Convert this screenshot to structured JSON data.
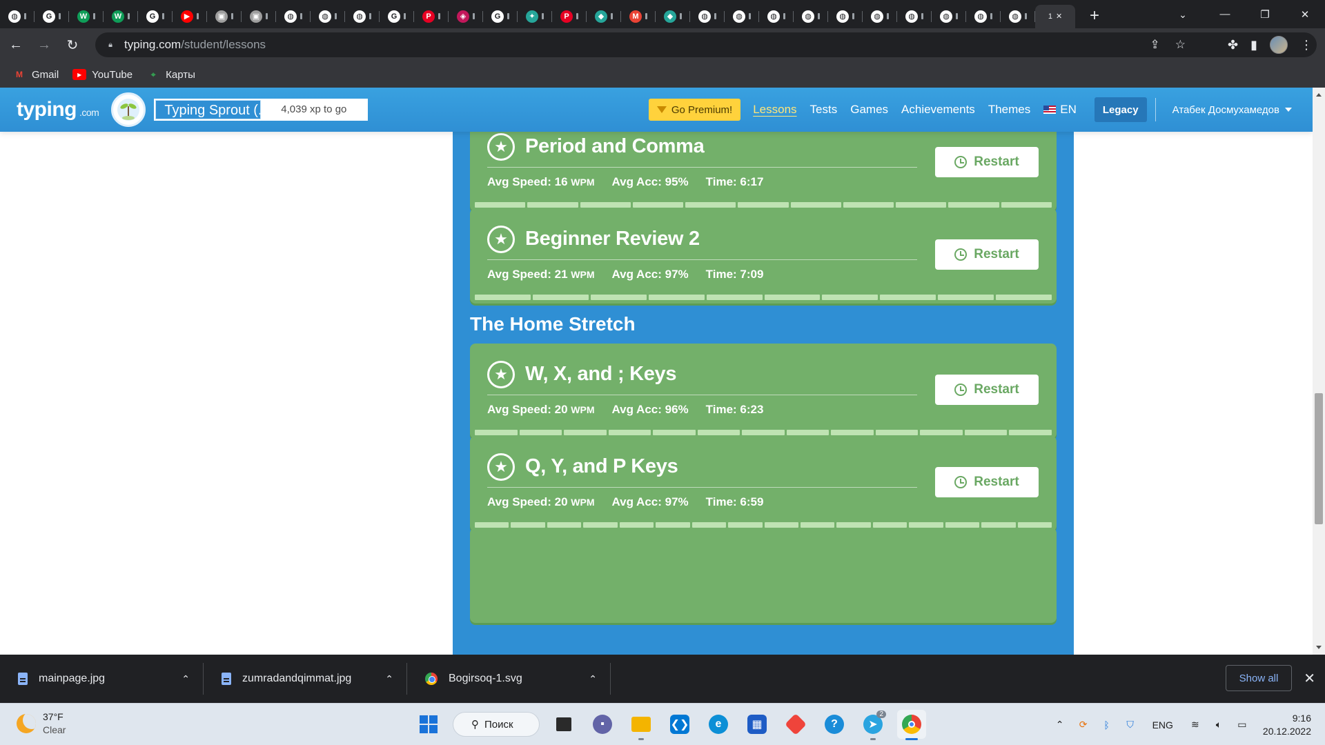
{
  "browser": {
    "tabs": [
      {
        "icon": "chrome-icon",
        "color": "#ffffff"
      },
      {
        "icon": "google-icon",
        "color": "#ffffff"
      },
      {
        "icon": "w-icon",
        "color": "#0f9d58"
      },
      {
        "icon": "w-icon",
        "color": "#0f9d58"
      },
      {
        "icon": "google-icon",
        "color": "#ffffff"
      },
      {
        "icon": "youtube-icon",
        "color": "#ff0000"
      },
      {
        "icon": "image-icon",
        "color": "#9e9e9e"
      },
      {
        "icon": "image-icon",
        "color": "#9e9e9e"
      },
      {
        "icon": "chrome-icon",
        "color": "#ffffff"
      },
      {
        "icon": "chrome-icon",
        "color": "#ffffff"
      },
      {
        "icon": "chrome-icon",
        "color": "#ffffff"
      },
      {
        "icon": "google-icon",
        "color": "#ffffff"
      },
      {
        "icon": "pinterest-icon",
        "color": "#e60023"
      },
      {
        "icon": "cube-icon",
        "color": "#c2185b"
      },
      {
        "icon": "google-icon",
        "color": "#ffffff"
      },
      {
        "icon": "spark-icon",
        "color": "#26a69a"
      },
      {
        "icon": "pinterest-icon",
        "color": "#e60023"
      },
      {
        "icon": "diamond-icon",
        "color": "#26a69a"
      },
      {
        "icon": "gmail-icon",
        "color": "#ea4335"
      },
      {
        "icon": "diamond-icon",
        "color": "#26a69a"
      },
      {
        "icon": "chrome-icon",
        "color": "#ffffff"
      },
      {
        "icon": "chrome-icon",
        "color": "#ffffff"
      },
      {
        "icon": "chrome-icon",
        "color": "#ffffff"
      },
      {
        "icon": "chrome-icon",
        "color": "#ffffff"
      },
      {
        "icon": "chrome-icon",
        "color": "#ffffff"
      },
      {
        "icon": "chrome-icon",
        "color": "#ffffff"
      },
      {
        "icon": "chrome-icon",
        "color": "#ffffff"
      },
      {
        "icon": "chrome-icon",
        "color": "#ffffff"
      },
      {
        "icon": "chrome-icon",
        "color": "#ffffff"
      },
      {
        "icon": "chrome-icon",
        "color": "#ffffff"
      }
    ],
    "active_tab_label": "1",
    "url_host": "typing.com",
    "url_path": "/student/lessons",
    "bookmarks": [
      {
        "label": "Gmail",
        "icon": "gmail-icon",
        "color": "#ea4335"
      },
      {
        "label": "YouTube",
        "icon": "youtube-icon",
        "color": "#ff0000"
      },
      {
        "label": "Карты",
        "icon": "maps-icon",
        "color": "#34a853"
      }
    ]
  },
  "site": {
    "logo": "typing",
    "logo_suffix": ".com",
    "level_name": "Typing Sprout (...",
    "xp_to_go": "4,039 xp to go",
    "premium_label": "Go Premium!",
    "nav": [
      "Lessons",
      "Tests",
      "Games",
      "Achievements",
      "Themes"
    ],
    "active_nav": "Lessons",
    "language": "EN",
    "legacy_label": "Legacy",
    "user_name": "Атабек Досмухамедов",
    "colors": {
      "header": "#2f8fd4",
      "card": "#73b06a",
      "premium": "#ffd23c"
    }
  },
  "lessons_top": [
    {
      "title": "Period and Comma",
      "speed_label": "Avg Speed: 16",
      "speed_unit": "WPM",
      "acc": "Avg Acc: 95%",
      "time": "Time: 6:17",
      "restart": "Restart",
      "progress_segments": 11
    },
    {
      "title": "Beginner Review 2",
      "speed_label": "Avg Speed: 21",
      "speed_unit": "WPM",
      "acc": "Avg Acc: 97%",
      "time": "Time: 7:09",
      "restart": "Restart",
      "progress_segments": 10
    }
  ],
  "section_title": "The Home Stretch",
  "lessons_bottom": [
    {
      "title": "W, X, and ; Keys",
      "speed_label": "Avg Speed: 20",
      "speed_unit": "WPM",
      "acc": "Avg Acc: 96%",
      "time": "Time: 6:23",
      "restart": "Restart",
      "progress_segments": 13
    },
    {
      "title": "Q, Y, and P Keys",
      "speed_label": "Avg Speed: 20",
      "speed_unit": "WPM",
      "acc": "Avg Acc: 97%",
      "time": "Time: 6:59",
      "restart": "Restart",
      "progress_segments": 16
    }
  ],
  "downloads": {
    "items": [
      {
        "name": "mainpage.jpg",
        "icon": "file-icon"
      },
      {
        "name": "zumradandqimmat.jpg",
        "icon": "file-icon"
      },
      {
        "name": "Bogirsoq-1.svg",
        "icon": "chrome-icon"
      }
    ],
    "show_all": "Show all"
  },
  "taskbar": {
    "temperature": "37°F",
    "condition": "Clear",
    "search_label": "Поиск",
    "telegram_badge": "2",
    "language": "ENG",
    "time": "9:16",
    "date": "20.12.2022"
  }
}
